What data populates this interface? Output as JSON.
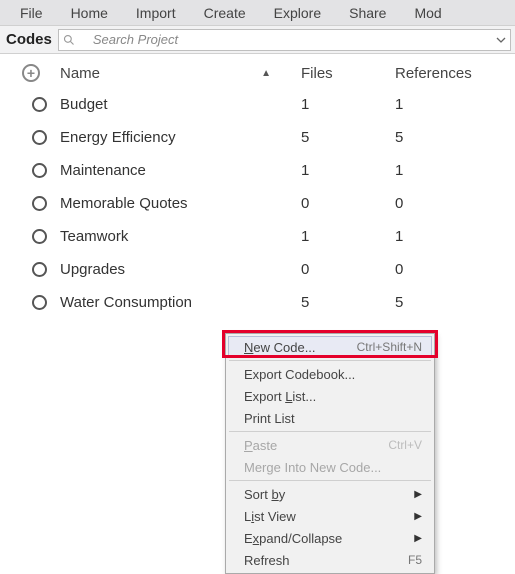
{
  "menubar": [
    "File",
    "Home",
    "Import",
    "Create",
    "Explore",
    "Share",
    "Mod"
  ],
  "panel_title": "Codes",
  "search": {
    "placeholder": "Search Project"
  },
  "columns": {
    "name": "Name",
    "files": "Files",
    "refs": "References"
  },
  "rows": [
    {
      "name": "Budget",
      "files": "1",
      "refs": "1"
    },
    {
      "name": "Energy Efficiency",
      "files": "5",
      "refs": "5"
    },
    {
      "name": "Maintenance",
      "files": "1",
      "refs": "1"
    },
    {
      "name": "Memorable Quotes",
      "files": "0",
      "refs": "0"
    },
    {
      "name": "Teamwork",
      "files": "1",
      "refs": "1"
    },
    {
      "name": "Upgrades",
      "files": "0",
      "refs": "0"
    },
    {
      "name": "Water Consumption",
      "files": "5",
      "refs": "5"
    }
  ],
  "context_menu": {
    "new_code": {
      "label": "New Code...",
      "shortcut": "Ctrl+Shift+N"
    },
    "export_codebook": "Export Codebook...",
    "export_list": "Export List...",
    "print_list": "Print List",
    "paste": {
      "label": "Paste",
      "shortcut": "Ctrl+V"
    },
    "merge": "Merge Into New Code...",
    "sort_by": "Sort by",
    "list_view": "List View",
    "expand_collapse": "Expand/Collapse",
    "refresh": {
      "label": "Refresh",
      "shortcut": "F5"
    }
  }
}
